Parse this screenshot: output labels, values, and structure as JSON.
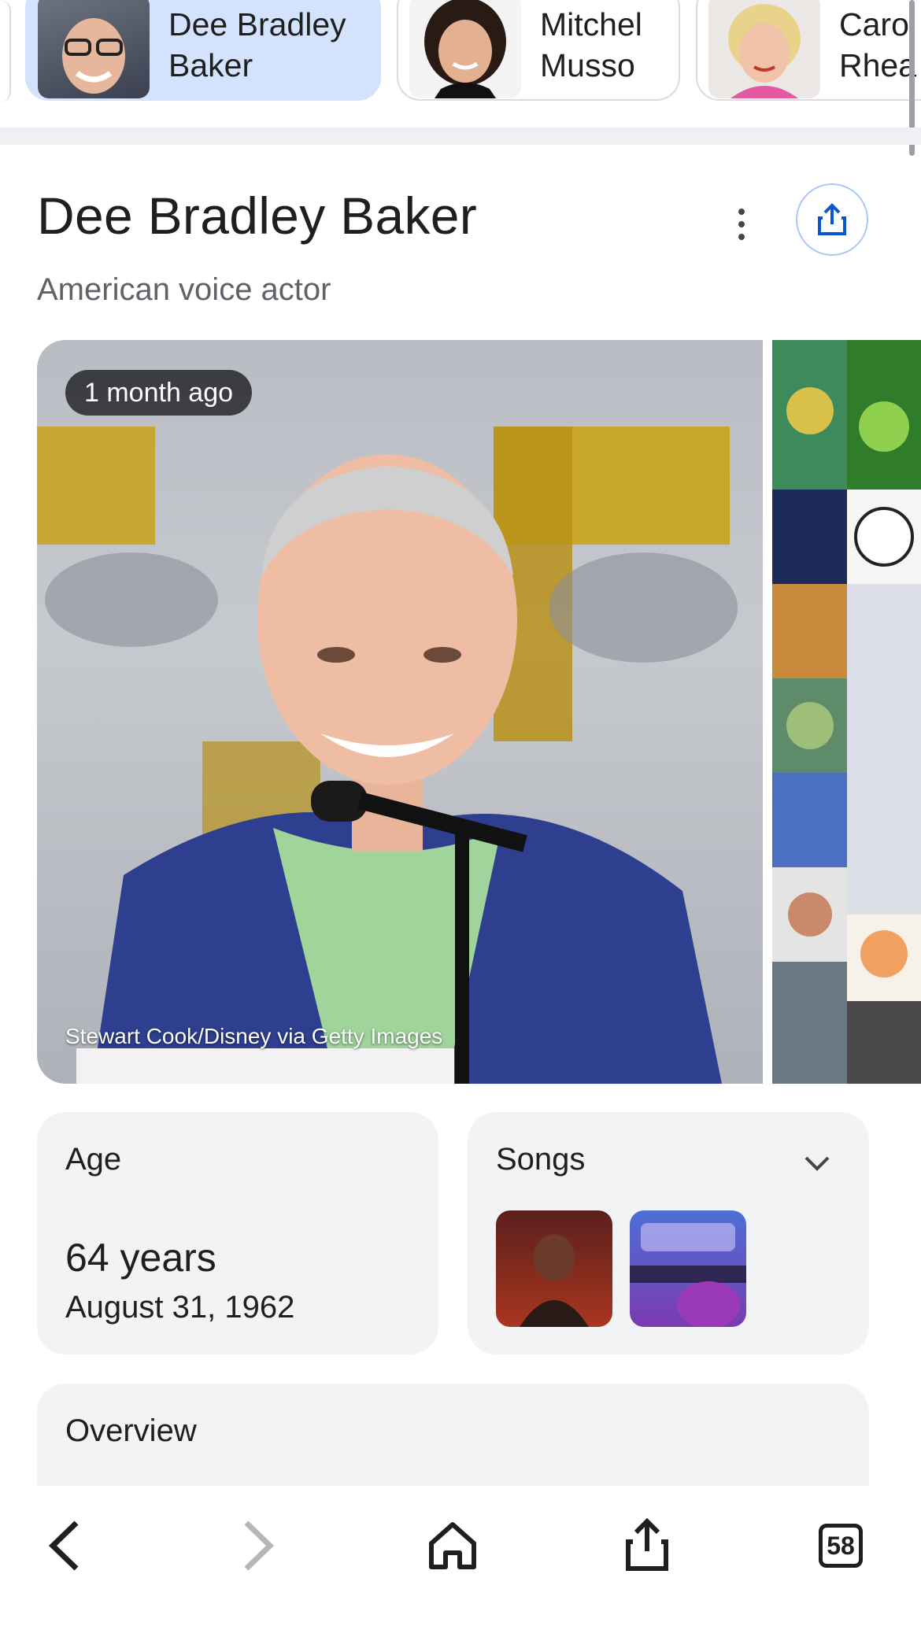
{
  "chips": [
    {
      "first": "Dee Bradley",
      "second": "Baker",
      "active": true
    },
    {
      "first": "Mitchel",
      "second": "Musso",
      "active": false
    },
    {
      "first": "Caro",
      "second": "Rhea",
      "active": false
    }
  ],
  "entity": {
    "name": "Dee Bradley Baker",
    "description": "American voice actor"
  },
  "hero": {
    "badge": "1 month ago",
    "credit": "Stewart Cook/Disney via Getty Images"
  },
  "age_card": {
    "label": "Age",
    "value": "64 years",
    "date": "August 31, 1962"
  },
  "songs_card": {
    "label": "Songs",
    "thumbs": [
      "song-thumbnail-1",
      "song-thumbnail-2"
    ]
  },
  "overview_card": {
    "label": "Overview"
  },
  "bottom_nav": {
    "tab_count": "58"
  },
  "colors": {
    "active_chip": "#d3e3fd",
    "card_bg": "#f1f3f4",
    "share_ring": "#a8c7fa"
  }
}
